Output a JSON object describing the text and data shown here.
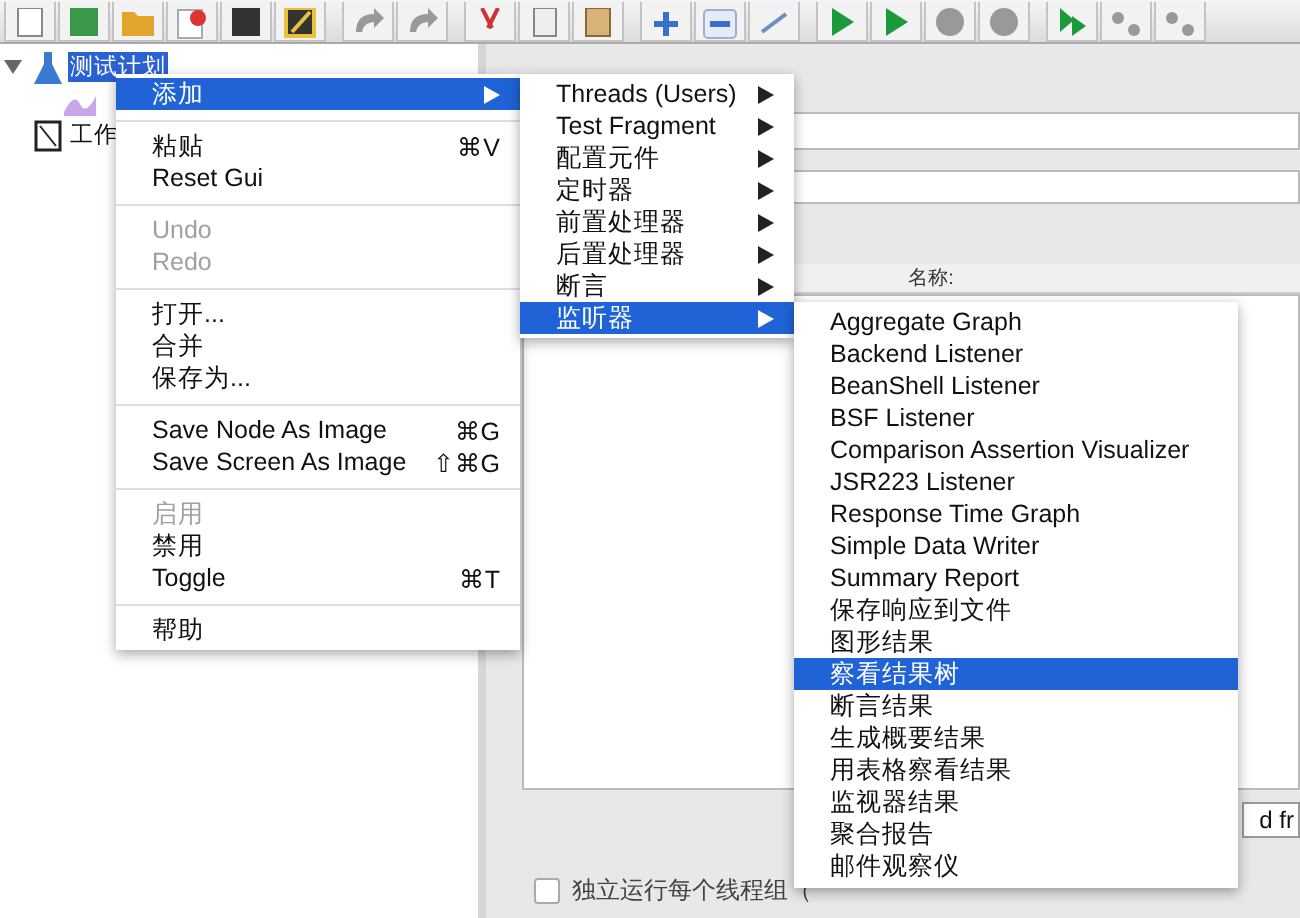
{
  "tree": [
    {
      "selected": true,
      "expanded": true,
      "kind": "plan",
      "label": "测试计划",
      "children": [
        {
          "kind": "listener"
        }
      ]
    },
    {
      "label": "工作",
      "selected": false,
      "kind": "workbench"
    }
  ],
  "context_menu": [
    [
      {
        "label": "添加",
        "disabled": false,
        "submenu": true,
        "selected": true
      }
    ],
    [
      {
        "label": "粘贴",
        "shortcut": "⌘V",
        "disabled": false,
        "submenu": false,
        "selected": false
      },
      {
        "label": "Reset Gui",
        "disabled": false,
        "submenu": false,
        "selected": false
      }
    ],
    [
      {
        "label": "Undo",
        "disabled": true,
        "submenu": false,
        "selected": false
      },
      {
        "label": "Redo",
        "disabled": true,
        "submenu": false,
        "selected": false
      }
    ],
    [
      {
        "label": "打开...",
        "disabled": false,
        "submenu": false,
        "selected": false
      },
      {
        "label": "合并",
        "disabled": false,
        "submenu": false,
        "selected": false
      },
      {
        "label": "保存为...",
        "disabled": false,
        "submenu": false,
        "selected": false
      }
    ],
    [
      {
        "label": "Save Node As Image",
        "shortcut": "⌘G",
        "disabled": false,
        "submenu": false,
        "selected": false
      },
      {
        "label": "Save Screen As Image",
        "shortcut": "⇧⌘G",
        "disabled": false,
        "submenu": false,
        "selected": false
      }
    ],
    [
      {
        "label": "启用",
        "disabled": true,
        "submenu": false,
        "selected": false
      },
      {
        "label": "禁用",
        "disabled": false,
        "submenu": false,
        "selected": false
      },
      {
        "label": "Toggle",
        "shortcut": "⌘T",
        "disabled": false,
        "submenu": false,
        "selected": false
      }
    ],
    [
      {
        "label": "帮助",
        "disabled": false,
        "submenu": false,
        "selected": false
      }
    ]
  ],
  "add_submenu": [
    {
      "label": "Threads (Users)",
      "selected": false
    },
    {
      "label": "Test Fragment",
      "selected": false
    },
    {
      "label": "配置元件",
      "selected": false
    },
    {
      "label": "定时器",
      "selected": false
    },
    {
      "label": "前置处理器",
      "selected": false
    },
    {
      "label": "后置处理器",
      "selected": false
    },
    {
      "label": "断言",
      "selected": false
    },
    {
      "label": "监听器",
      "selected": true
    }
  ],
  "listener_submenu": [
    {
      "label": "Aggregate Graph",
      "selected": false
    },
    {
      "label": "Backend Listener",
      "selected": false
    },
    {
      "label": "BeanShell Listener",
      "selected": false
    },
    {
      "label": "BSF Listener",
      "selected": false
    },
    {
      "label": "Comparison Assertion Visualizer",
      "selected": false
    },
    {
      "label": "JSR223 Listener",
      "selected": false
    },
    {
      "label": "Response Time Graph",
      "selected": false
    },
    {
      "label": "Simple Data Writer",
      "selected": false
    },
    {
      "label": "Summary Report",
      "selected": false
    },
    {
      "label": "保存响应到文件",
      "selected": false
    },
    {
      "label": "图形结果",
      "selected": false
    },
    {
      "label": "察看结果树",
      "selected": true
    },
    {
      "label": "断言结果",
      "selected": false
    },
    {
      "label": "生成概要结果",
      "selected": false
    },
    {
      "label": "用表格察看结果",
      "selected": false
    },
    {
      "label": "监视器结果",
      "selected": false
    },
    {
      "label": "聚合报告",
      "selected": false
    },
    {
      "label": "邮件观察仪",
      "selected": false
    }
  ],
  "panel": {
    "table_header": "名称:",
    "side_field": "d fr",
    "checkbox": {
      "label": "独立运行每个线程组（",
      "checked": false
    }
  }
}
